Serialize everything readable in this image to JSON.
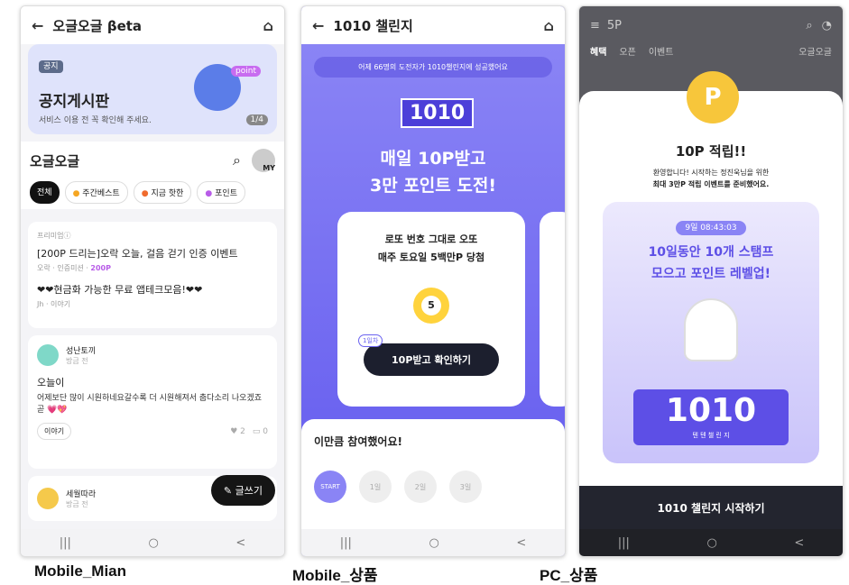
{
  "screen1": {
    "title": "오글오글 βeta",
    "notice": {
      "badge": "공지",
      "title": "공지게시판",
      "sub": "서비스 이용 전 꼭 확인해 주세요.",
      "counter": "1/4",
      "char_label": "point"
    },
    "section_title": "오글오글",
    "my_label": "MY",
    "chips": [
      "전체",
      "주간베스트",
      "지금 핫한",
      "포인트"
    ],
    "premium": {
      "label": "프리미엄ⓘ",
      "title": "[200P 드리는]오락 오늘, 걸음 걷기 인증 이벤트",
      "meta": "오락 · 인증미션 ·",
      "points": "200P",
      "title2": "❤❤현금화 가능한 무료 앱테크모음!❤❤",
      "meta2": "Jh · 이야기"
    },
    "post": {
      "author": "성난토끼",
      "time": "방금 전",
      "title": "오늘이",
      "body": "어제보단 많이 시원하네요갈수록 더 시원해져서 춥다소리 나오겠죠 곧 💗💖",
      "tag": "이야기",
      "likes": "2",
      "comments": "0"
    },
    "post2": {
      "author": "세월따라",
      "time": "방금 전"
    },
    "write_button": "글쓰기"
  },
  "screen2": {
    "title": "1010 챌린지",
    "banner": "어제 66명의 도전자가 1010챌린지에 성공했어요",
    "logo": "1010",
    "headline1": "매일 10P받고",
    "headline2": "3만 포인트 도전!",
    "card_line1": "로또 번호 그대로 오또",
    "card_line2": "매주 토요일 5백만P 당첨",
    "ball": "5",
    "day_badge": "1일차",
    "card_button": "10P받고 확인하기",
    "participation": "이만큼 참여했어요!",
    "stamps": [
      "START",
      "1일",
      "2일",
      "3일"
    ]
  },
  "screen3": {
    "status": "5P",
    "tabs": [
      "혜택",
      "오픈",
      "이벤트"
    ],
    "brand": "오글오글",
    "coin": "P",
    "modal_title": "10P 적립!!",
    "modal_line1": "환영합니다! 시작하는 정진욱님을 위한",
    "modal_line2": "최대 3만P 적립 이벤트를 준비했어요.",
    "timer": "9일 08:43:03",
    "promo1": "10일동안 10개 스탬프",
    "promo2": "모으고 포인트 레벨업!",
    "logo": "1010",
    "logo_sub": "텐 텐 챌 린 지",
    "cta": "1010 챌린지 시작하기"
  },
  "nav": [
    "|||",
    "○",
    "<"
  ],
  "captions": [
    "Mobile_Mian",
    "Mobile_상품",
    "PC_상품"
  ]
}
